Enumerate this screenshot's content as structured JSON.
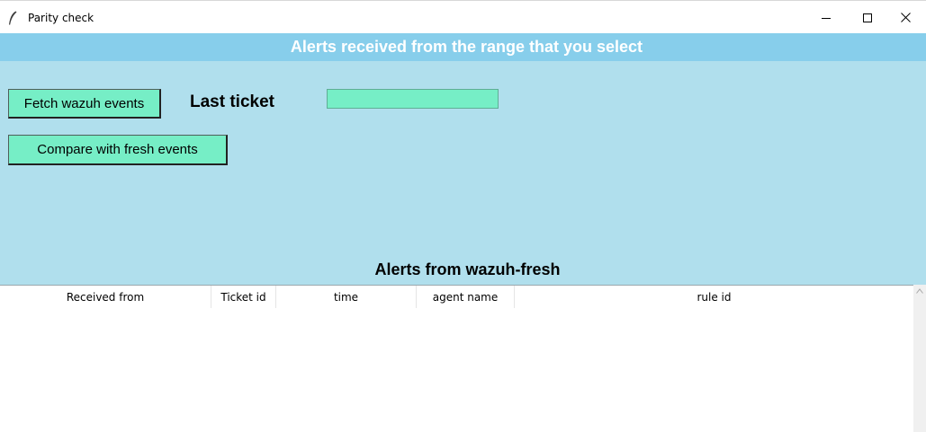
{
  "window": {
    "title": "Parity check",
    "icon": "feather-icon",
    "controls": [
      "minimize-icon",
      "maximize-icon",
      "close-icon"
    ]
  },
  "header": {
    "title": "Alerts received from the range that you select"
  },
  "controls": {
    "fetch_label": "Fetch wazuh events",
    "compare_label": "Compare with fresh events",
    "last_ticket_label": "Last ticket",
    "last_ticket_value": ""
  },
  "table": {
    "title": "Alerts from wazuh-fresh",
    "columns": [
      "Received from",
      "Ticket id",
      "time",
      "agent name",
      "rule id"
    ],
    "rows": []
  },
  "colors": {
    "header_band": "#87ceeb",
    "main_background": "#b0dfed",
    "button": "#76eec6",
    "entry": "#76eec6"
  }
}
